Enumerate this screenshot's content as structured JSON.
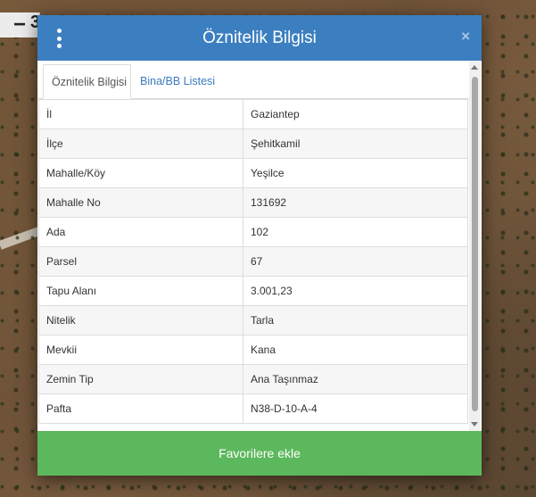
{
  "map": {
    "zoom_out_label": "−",
    "partial_label": "3"
  },
  "dialog": {
    "title": "Öznitelik Bilgisi",
    "close_label": "×",
    "menu_icon": "vertical-dots-icon"
  },
  "tabs": [
    {
      "label": "Öznitelik Bilgisi",
      "active": true
    },
    {
      "label": "Bina/BB Listesi",
      "active": false
    }
  ],
  "attributes": [
    {
      "key": "İl",
      "value": "Gaziantep"
    },
    {
      "key": "İlçe",
      "value": "Şehitkamil"
    },
    {
      "key": "Mahalle/Köy",
      "value": "Yeşilce"
    },
    {
      "key": "Mahalle No",
      "value": "131692"
    },
    {
      "key": "Ada",
      "value": "102"
    },
    {
      "key": "Parsel",
      "value": "67"
    },
    {
      "key": "Tapu Alanı",
      "value": "3.001,23"
    },
    {
      "key": "Nitelik",
      "value": "Tarla"
    },
    {
      "key": "Mevkii",
      "value": "Kana"
    },
    {
      "key": "Zemin Tip",
      "value": "Ana Taşınmaz"
    },
    {
      "key": "Pafta",
      "value": "N38-D-10-A-4"
    }
  ],
  "footer": {
    "favorite_label": "Favorilere ekle"
  },
  "colors": {
    "header": "#3c7fc0",
    "button": "#5cb85c",
    "tab_link": "#3a7bbf"
  }
}
